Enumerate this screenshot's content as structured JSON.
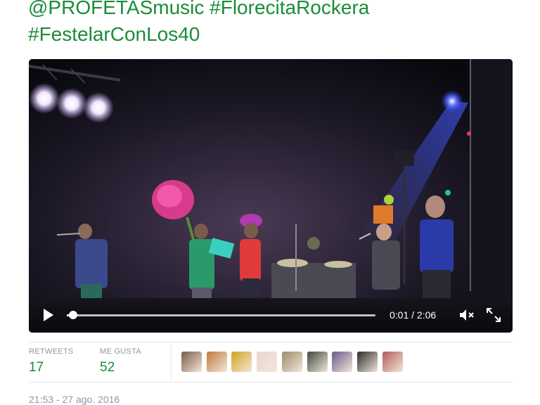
{
  "tweet": {
    "line1": "@PROFETASmusic #FlorecitaRockera",
    "line2": "#FestelarConLos40"
  },
  "video": {
    "time": "0:01 / 2:06",
    "progress": 0.02,
    "play_icon": "play-icon",
    "mute_icon": "volume-muted-icon",
    "fullscreen_icon": "fullscreen-icon"
  },
  "stats": {
    "retweets_label": "RETWEETS",
    "retweets_value": "17",
    "likes_label": "ME GUSTA",
    "likes_value": "52"
  },
  "avatars": [
    {
      "name": "user-avatar-1",
      "color": "#7a5a46"
    },
    {
      "name": "user-avatar-2",
      "color": "#c07a3a"
    },
    {
      "name": "user-avatar-3",
      "color": "#d4a21e"
    },
    {
      "name": "user-avatar-4",
      "color": "#e8d8cf"
    },
    {
      "name": "user-avatar-5",
      "color": "#9a8c6a"
    },
    {
      "name": "user-avatar-6",
      "color": "#3d4a3a"
    },
    {
      "name": "user-avatar-7",
      "color": "#6a5a8c"
    },
    {
      "name": "user-avatar-8",
      "color": "#2a2a2a"
    },
    {
      "name": "user-avatar-9",
      "color": "#b45a5a"
    }
  ],
  "timestamp": "21:53 - 27 ago. 2016",
  "colors": {
    "accent": "#1a8c3a",
    "muted_text": "#8899a6"
  }
}
